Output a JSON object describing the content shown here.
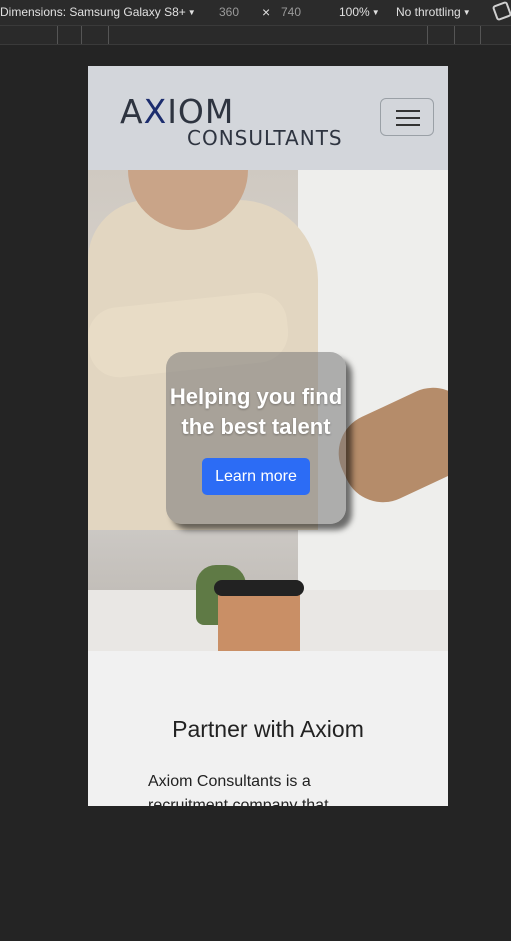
{
  "devtools": {
    "device": "Dimensions: Samsung Galaxy S8+",
    "width": "360",
    "times": "×",
    "height": "740",
    "zoom": "100%",
    "throttle": "No throttling",
    "rotate_icon": "rotate-icon"
  },
  "site": {
    "logo_main": "A",
    "logo_x": "X",
    "logo_rest": "IOM",
    "logo_sub": "CONSULTANTS",
    "menu_icon": "hamburger-icon",
    "hero_title": "Helping you find the best talent",
    "hero_button": "Learn more",
    "section_title": "Partner with Axiom",
    "section_text": "Axiom Consultants is a recruitment company that"
  },
  "colors": {
    "accent": "#2c6cf5",
    "navbar": "#d3d6db",
    "page_bg": "#242424"
  }
}
